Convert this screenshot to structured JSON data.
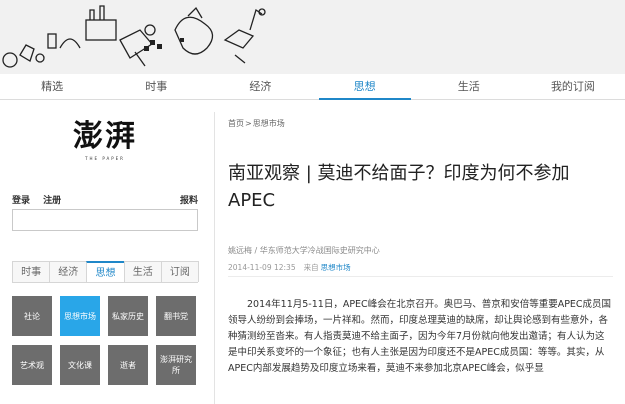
{
  "nav": {
    "tabs": [
      {
        "label": "精选"
      },
      {
        "label": "时事"
      },
      {
        "label": "经济"
      },
      {
        "label": "思想"
      },
      {
        "label": "生活"
      },
      {
        "label": "我的订阅"
      }
    ],
    "active_index": 3
  },
  "sidebar": {
    "logo_zh": "澎湃",
    "logo_en": "THE PAPER",
    "login": "登录",
    "register": "注册",
    "report": "报料",
    "tabs": [
      {
        "label": "时事"
      },
      {
        "label": "经济"
      },
      {
        "label": "思想"
      },
      {
        "label": "生活"
      },
      {
        "label": "订阅"
      }
    ],
    "active_tab_index": 2,
    "grid": [
      {
        "label": "社论"
      },
      {
        "label": "思想市场"
      },
      {
        "label": "私家历史"
      },
      {
        "label": "翻书党"
      },
      {
        "label": "艺术观"
      },
      {
        "label": "文化课"
      },
      {
        "label": "逝者"
      },
      {
        "label": "澎湃研究所"
      }
    ],
    "active_grid_index": 1
  },
  "article": {
    "breadcrumb": {
      "home": "首页",
      "sep": ">",
      "section": "思想市场"
    },
    "title": "南亚观察 | 莫迪不给面子？印度为何不参加APEC",
    "author": "姚远梅 / 华东师范大学冷战国际史研究中心",
    "datetime": "2014-11-09 12:35",
    "source_label": "来自",
    "source": "思想市场",
    "body": "2014年11月5-11日，APEC峰会在北京召开。奥巴马、普京和安倍等重要APEC成员国领导人纷纷到会捧场，一片祥和。然而，印度总理莫迪的缺席，却让舆论感到有些意外，各种猜测纷至沓来。有人指责莫迪不给主面子，因为今年7月份就向他发出邀请；有人认为这是中印关系变坏的一个象征；也有人主张是因为印度还不是APEC成员国：等等。其实，从APEC内部发展趋势及印度立场来看，莫迪不来参加北京APEC峰会，似乎显"
  },
  "colors": {
    "accent": "#1f87c8",
    "grid_active": "#29a6e8",
    "grid_default": "#6d6d6d"
  }
}
